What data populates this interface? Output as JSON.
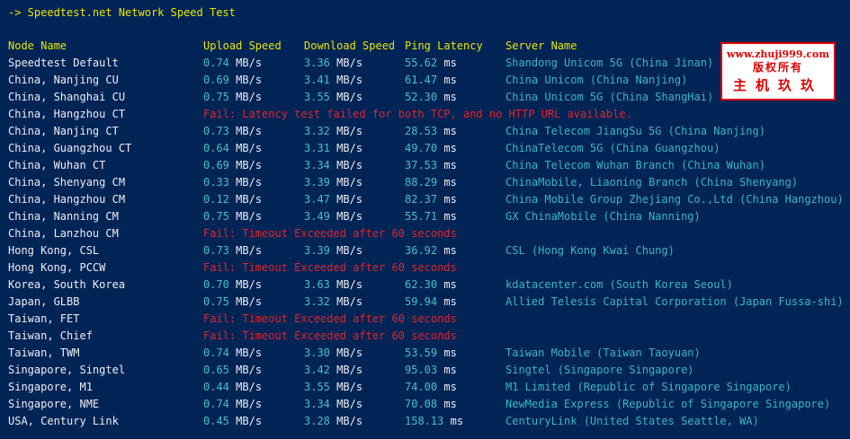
{
  "title": "-> Speedtest.net Network Speed Test",
  "headers": {
    "node": "Node Name",
    "upload": "Upload Speed",
    "download": "Download Speed",
    "latency": "Ping Latency",
    "server": "Server Name"
  },
  "units": {
    "speed": "MB/s",
    "latency": "ms"
  },
  "rows": [
    {
      "node": "Speedtest Default",
      "up": "0.74",
      "down": "3.36",
      "lat": "55.62",
      "server": "Shandong Unicom 5G (China Jinan)"
    },
    {
      "node": "China, Nanjing CU",
      "up": "0.69",
      "down": "3.41",
      "lat": "61.47",
      "server": "China Unicom (China Nanjing)"
    },
    {
      "node": "China, Shanghai CU",
      "up": "0.75",
      "down": "3.55",
      "lat": "52.30",
      "server": "China Unicom 5G (China ShangHai)"
    },
    {
      "node": "China, Hangzhou CT",
      "fail": "Fail: Latency test failed for both TCP, and no HTTP URL available."
    },
    {
      "node": "China, Nanjing CT",
      "up": "0.73",
      "down": "3.32",
      "lat": "28.53",
      "server": "China Telecom JiangSu 5G (China Nanjing)"
    },
    {
      "node": "China, Guangzhou CT",
      "up": "0.64",
      "down": "3.31",
      "lat": "49.70",
      "server": "ChinaTelecom 5G (China Guangzhou)"
    },
    {
      "node": "China, Wuhan CT",
      "up": "0.69",
      "down": "3.34",
      "lat": "37.53",
      "server": "China Telecom Wuhan Branch (China Wuhan)"
    },
    {
      "node": "China, Shenyang CM",
      "up": "0.33",
      "down": "3.39",
      "lat": "88.29",
      "server": "ChinaMobile, Liaoning Branch (China Shenyang)"
    },
    {
      "node": "China, Hangzhou CM",
      "up": "0.12",
      "down": "3.47",
      "lat": "82.37",
      "server": "China Mobile Group Zhejiang Co.,Ltd (China Hangzhou)"
    },
    {
      "node": "China, Nanning CM",
      "up": "0.75",
      "down": "3.49",
      "lat": "55.71",
      "server": "GX ChinaMobile (China Nanning)"
    },
    {
      "node": "China, Lanzhou CM",
      "fail": "Fail: Timeout Exceeded after 60 seconds"
    },
    {
      "node": "Hong Kong, CSL",
      "up": "0.73",
      "down": "3.39",
      "lat": "36.92",
      "server": "CSL (Hong Kong Kwai Chung)"
    },
    {
      "node": "Hong Kong, PCCW",
      "fail": "Fail: Timeout Exceeded after 60 seconds"
    },
    {
      "node": "Korea, South Korea",
      "up": "0.70",
      "down": "3.63",
      "lat": "62.30",
      "server": "kdatacenter.com (South Korea Seoul)"
    },
    {
      "node": "Japan, GLBB",
      "up": "0.75",
      "down": "3.32",
      "lat": "59.94",
      "server": "Allied Telesis Capital Corporation (Japan Fussa-shi)"
    },
    {
      "node": "Taiwan, FET",
      "fail": "Fail: Timeout Exceeded after 60 seconds"
    },
    {
      "node": "Taiwan, Chief",
      "fail": "Fail: Timeout Exceeded after 60 seconds"
    },
    {
      "node": "Taiwan, TWM",
      "up": "0.74",
      "down": "3.30",
      "lat": "53.59",
      "server": "Taiwan Mobile (Taiwan Taoyuan)"
    },
    {
      "node": "Singapore, Singtel",
      "up": "0.65",
      "down": "3.42",
      "lat": "95.03",
      "server": "Singtel (Singapore Singapore)"
    },
    {
      "node": "Singapore, M1",
      "up": "0.44",
      "down": "3.55",
      "lat": "74.00",
      "server": "M1 Limited (Republic of Singapore Singapore)"
    },
    {
      "node": "Singapore, NME",
      "up": "0.74",
      "down": "3.34",
      "lat": "70.08",
      "server": "NewMedia Express (Republic of Singapore Singapore)"
    },
    {
      "node": "USA, Century Link",
      "up": "0.45",
      "down": "3.28",
      "lat": "158.13",
      "server": "CenturyLink (United States Seattle, WA)"
    }
  ],
  "watermark": {
    "line1": "www.zhuji999.com",
    "line2": "版权所有",
    "line3": "主机玖玖"
  },
  "colors": {
    "background": "#012456",
    "header": "#e8e600",
    "value": "#44c0c8",
    "server": "#3ab6c6",
    "fail": "#e0242c",
    "text": "#eeedf0",
    "watermark": "#e00000"
  }
}
